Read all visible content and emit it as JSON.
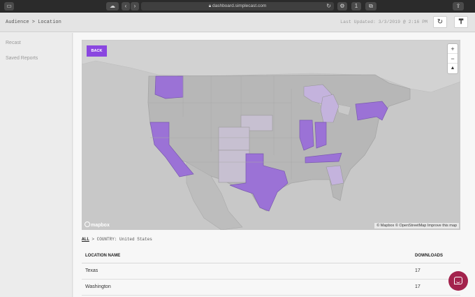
{
  "browser": {
    "url": "dashboard.simplecast.com",
    "icons": [
      "sidebar-icon",
      "cloud-icon",
      "back-icon",
      "forward-icon",
      "lock-icon",
      "reload-icon",
      "extension-icon",
      "shield-icon",
      "tab-icon",
      "share-icon"
    ]
  },
  "header": {
    "breadcrumb": "Audience > Location",
    "last_updated": "Last Updated: 3/3/2019 @ 2:16 PM",
    "refresh_icon": "refresh-icon",
    "pin_icon": "pin-icon"
  },
  "sidebar": {
    "items": [
      {
        "label": "Recast"
      },
      {
        "label": "Saved Reports"
      }
    ]
  },
  "map": {
    "back_label": "BACK",
    "zoom_in": "+",
    "zoom_out": "−",
    "compass": "▲",
    "logo_text": "mapbox",
    "attribution": "© Mapbox © OpenStreetMap Improve this map",
    "highlight_color": "#9b72d6",
    "highlight_color_light": "#c4b3dd"
  },
  "filter": {
    "all_label": "ALL",
    "path": "> COUNTRY: United States"
  },
  "table": {
    "columns": [
      "LOCATION NAME",
      "DOWNLOADS"
    ],
    "rows": [
      {
        "name": "Texas",
        "downloads": "17"
      },
      {
        "name": "Washington",
        "downloads": "17"
      }
    ]
  },
  "chat": {
    "icon": "chat-icon"
  }
}
